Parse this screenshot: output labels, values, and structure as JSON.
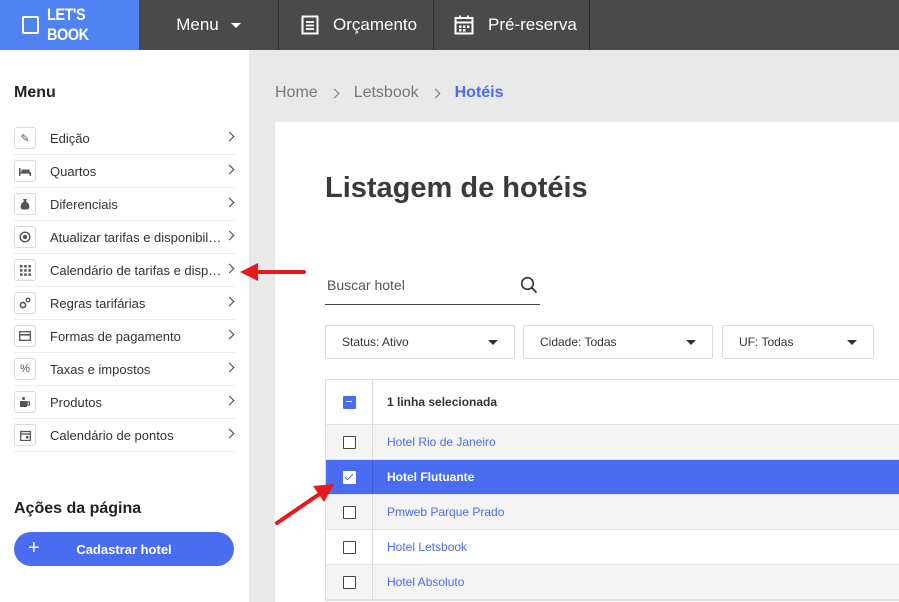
{
  "topbar": {
    "logo": "LET'S BOOK",
    "menu_label": "Menu",
    "orcamento_label": "Orçamento",
    "prereserva_label": "Pré-reserva"
  },
  "sidebar": {
    "title": "Menu",
    "items": [
      {
        "label": "Edição",
        "icon": "pencil-icon"
      },
      {
        "label": "Quartos",
        "icon": "bed-icon"
      },
      {
        "label": "Diferenciais",
        "icon": "money-bag-icon"
      },
      {
        "label": "Atualizar tarifas e disponibilidade",
        "icon": "refresh-money-icon"
      },
      {
        "label": "Calendário de tarifas e disponibilidade",
        "icon": "calendar-grid-icon"
      },
      {
        "label": "Regras tarifárias",
        "icon": "gears-icon"
      },
      {
        "label": "Formas de pagamento",
        "icon": "payment-icon"
      },
      {
        "label": "Taxas e impostos",
        "icon": "percent-icon"
      },
      {
        "label": "Produtos",
        "icon": "products-icon"
      },
      {
        "label": "Calendário de pontos",
        "icon": "calendar-icon"
      }
    ],
    "actions_title": "Ações da página",
    "add_button": "Cadastrar hotel"
  },
  "breadcrumb": {
    "home": "Home",
    "letsbook": "Letsbook",
    "current": "Hotéis"
  },
  "main": {
    "title": "Listagem de hotéis",
    "search_placeholder": "Buscar hotel",
    "filters": {
      "status": "Status: Ativo",
      "cidade": "Cidade: Todas",
      "uf": "UF: Todas"
    },
    "table": {
      "header": "1 linha selecionada",
      "rows": [
        {
          "name": "Hotel Rio de Janeiro",
          "checked": false
        },
        {
          "name": "Hotel Flutuante",
          "checked": true
        },
        {
          "name": "Pmweb Parque Prado",
          "checked": false
        },
        {
          "name": "Hotel Letsbook",
          "checked": false
        },
        {
          "name": "Hotel Absoluto",
          "checked": false
        }
      ]
    }
  },
  "colors": {
    "accent": "#4a6cf0",
    "topbar": "#4a4a4a",
    "logo_bg": "#4f83f1",
    "arrow": "#e8191b"
  }
}
